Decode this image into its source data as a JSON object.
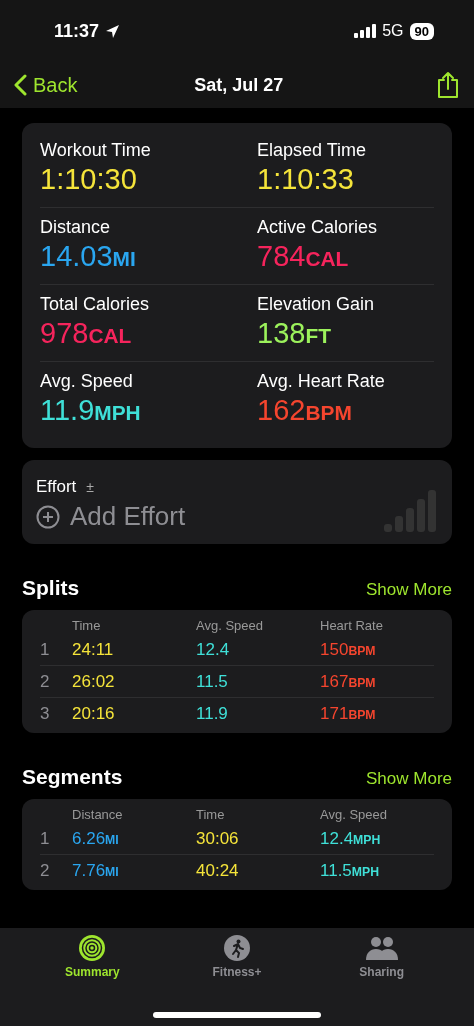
{
  "status_bar": {
    "time": "11:37",
    "network": "5G",
    "battery": "90"
  },
  "nav": {
    "back": "Back",
    "title": "Sat, Jul 27"
  },
  "metrics": [
    {
      "label": "Workout Time",
      "value": "1:10:30",
      "color": "#f5e43a"
    },
    {
      "label": "Elapsed Time",
      "value": "1:10:33",
      "color": "#f5e43a"
    },
    {
      "label": "Distance",
      "value": "14.03",
      "unit": "MI",
      "color": "#2aa6f0"
    },
    {
      "label": "Active Calories",
      "value": "784",
      "unit": "CAL",
      "color": "#f5245c"
    },
    {
      "label": "Total Calories",
      "value": "978",
      "unit": "CAL",
      "color": "#f5245c"
    },
    {
      "label": "Elevation Gain",
      "value": "138",
      "unit": "FT",
      "color": "#9cf25c"
    },
    {
      "label": "Avg. Speed",
      "value": "11.9",
      "unit": "MPH",
      "color": "#3fe0d8"
    },
    {
      "label": "Avg. Heart Rate",
      "value": "162",
      "unit": "BPM",
      "color": "#f5452e"
    }
  ],
  "effort": {
    "label": "Effort",
    "mark": "±",
    "action": "Add Effort"
  },
  "splits": {
    "title": "Splits",
    "more": "Show More",
    "columns": [
      {
        "label": "Time",
        "color": "#f5e43a"
      },
      {
        "label": "Avg. Speed",
        "color": "#3fe0d8"
      },
      {
        "label": "Heart Rate",
        "color": "#f5452e"
      }
    ],
    "rows": [
      {
        "index": "1",
        "cells": [
          {
            "value": "24:11"
          },
          {
            "value": "12.4"
          },
          {
            "value": "150",
            "unit": "BPM"
          }
        ]
      },
      {
        "index": "2",
        "cells": [
          {
            "value": "26:02"
          },
          {
            "value": "11.5"
          },
          {
            "value": "167",
            "unit": "BPM"
          }
        ]
      },
      {
        "index": "3",
        "cells": [
          {
            "value": "20:16"
          },
          {
            "value": "11.9"
          },
          {
            "value": "171",
            "unit": "BPM"
          }
        ]
      }
    ]
  },
  "segments": {
    "title": "Segments",
    "more": "Show More",
    "columns": [
      {
        "label": "Distance",
        "color": "#2aa6f0"
      },
      {
        "label": "Time",
        "color": "#f5e43a"
      },
      {
        "label": "Avg. Speed",
        "color": "#3fe0d8"
      }
    ],
    "rows": [
      {
        "index": "1",
        "cells": [
          {
            "value": "6.26",
            "unit": "MI"
          },
          {
            "value": "30:06"
          },
          {
            "value": "12.4",
            "unit": "MPH"
          }
        ]
      },
      {
        "index": "2",
        "cells": [
          {
            "value": "7.76",
            "unit": "MI"
          },
          {
            "value": "40:24"
          },
          {
            "value": "11.5",
            "unit": "MPH"
          }
        ]
      }
    ]
  },
  "tabs": [
    {
      "label": "Summary",
      "kind": "rings",
      "selected": true
    },
    {
      "label": "Fitness+",
      "kind": "runner",
      "selected": false
    },
    {
      "label": "Sharing",
      "kind": "people",
      "selected": false
    }
  ]
}
